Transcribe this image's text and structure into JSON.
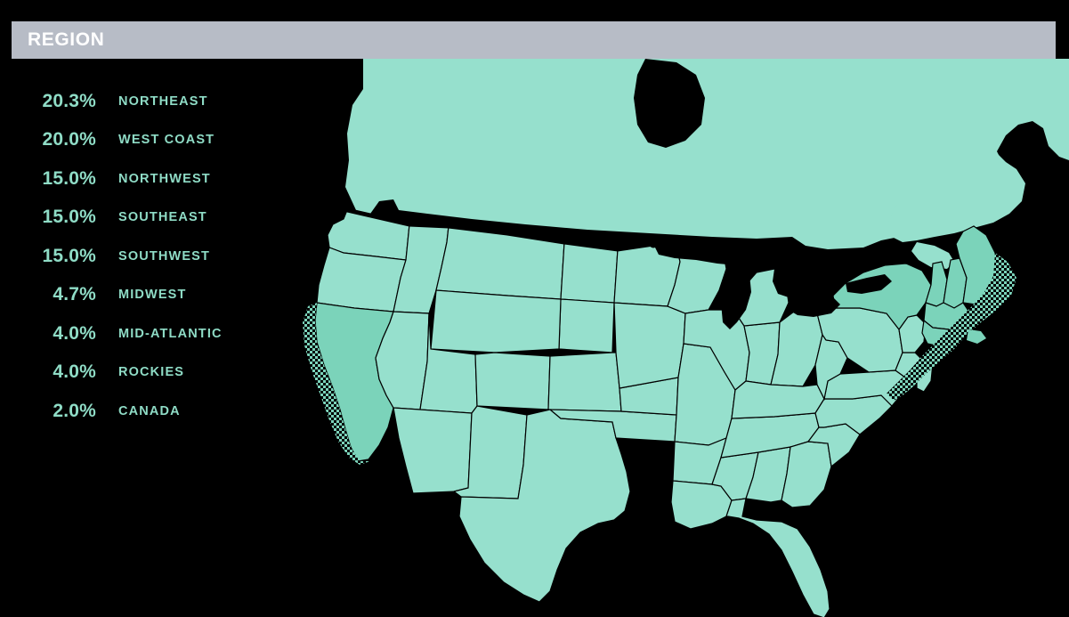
{
  "header": {
    "title": "REGION",
    "bar_color": "#b7bcc6",
    "title_color": "#ffffff"
  },
  "theme": {
    "background": "#000000",
    "accent": "#8fdcc6",
    "map_base_fill": "#96e0cd",
    "map_highlight_fill": "#7bd3ba",
    "map_stroke": "#000000"
  },
  "chart_data": {
    "type": "map",
    "title": "REGION",
    "value_unit": "%",
    "categories": [
      "NORTHEAST",
      "WEST COAST",
      "NORTHWEST",
      "SOUTHEAST",
      "SOUTHWEST",
      "MIDWEST",
      "MID-ATLANTIC",
      "ROCKIES",
      "CANADA"
    ],
    "values": [
      20.3,
      20.0,
      15.0,
      15.0,
      15.0,
      4.7,
      4.0,
      4.0,
      2.0
    ],
    "legend_position": "left",
    "grid": false
  },
  "legend": {
    "rows": [
      {
        "pct": "20.3%",
        "label": "NORTHEAST"
      },
      {
        "pct": "20.0%",
        "label": "WEST COAST"
      },
      {
        "pct": "15.0%",
        "label": "NORTHWEST"
      },
      {
        "pct": "15.0%",
        "label": "SOUTHEAST"
      },
      {
        "pct": "15.0%",
        "label": "SOUTHWEST"
      },
      {
        "pct": "4.7%",
        "label": "MIDWEST"
      },
      {
        "pct": "4.0%",
        "label": "MID-ATLANTIC"
      },
      {
        "pct": "4.0%",
        "label": "ROCKIES"
      },
      {
        "pct": "2.0%",
        "label": "CANADA"
      }
    ]
  },
  "map": {
    "region_name": "North America",
    "highlighted_areas": [
      "WEST COAST",
      "NORTHEAST"
    ]
  }
}
